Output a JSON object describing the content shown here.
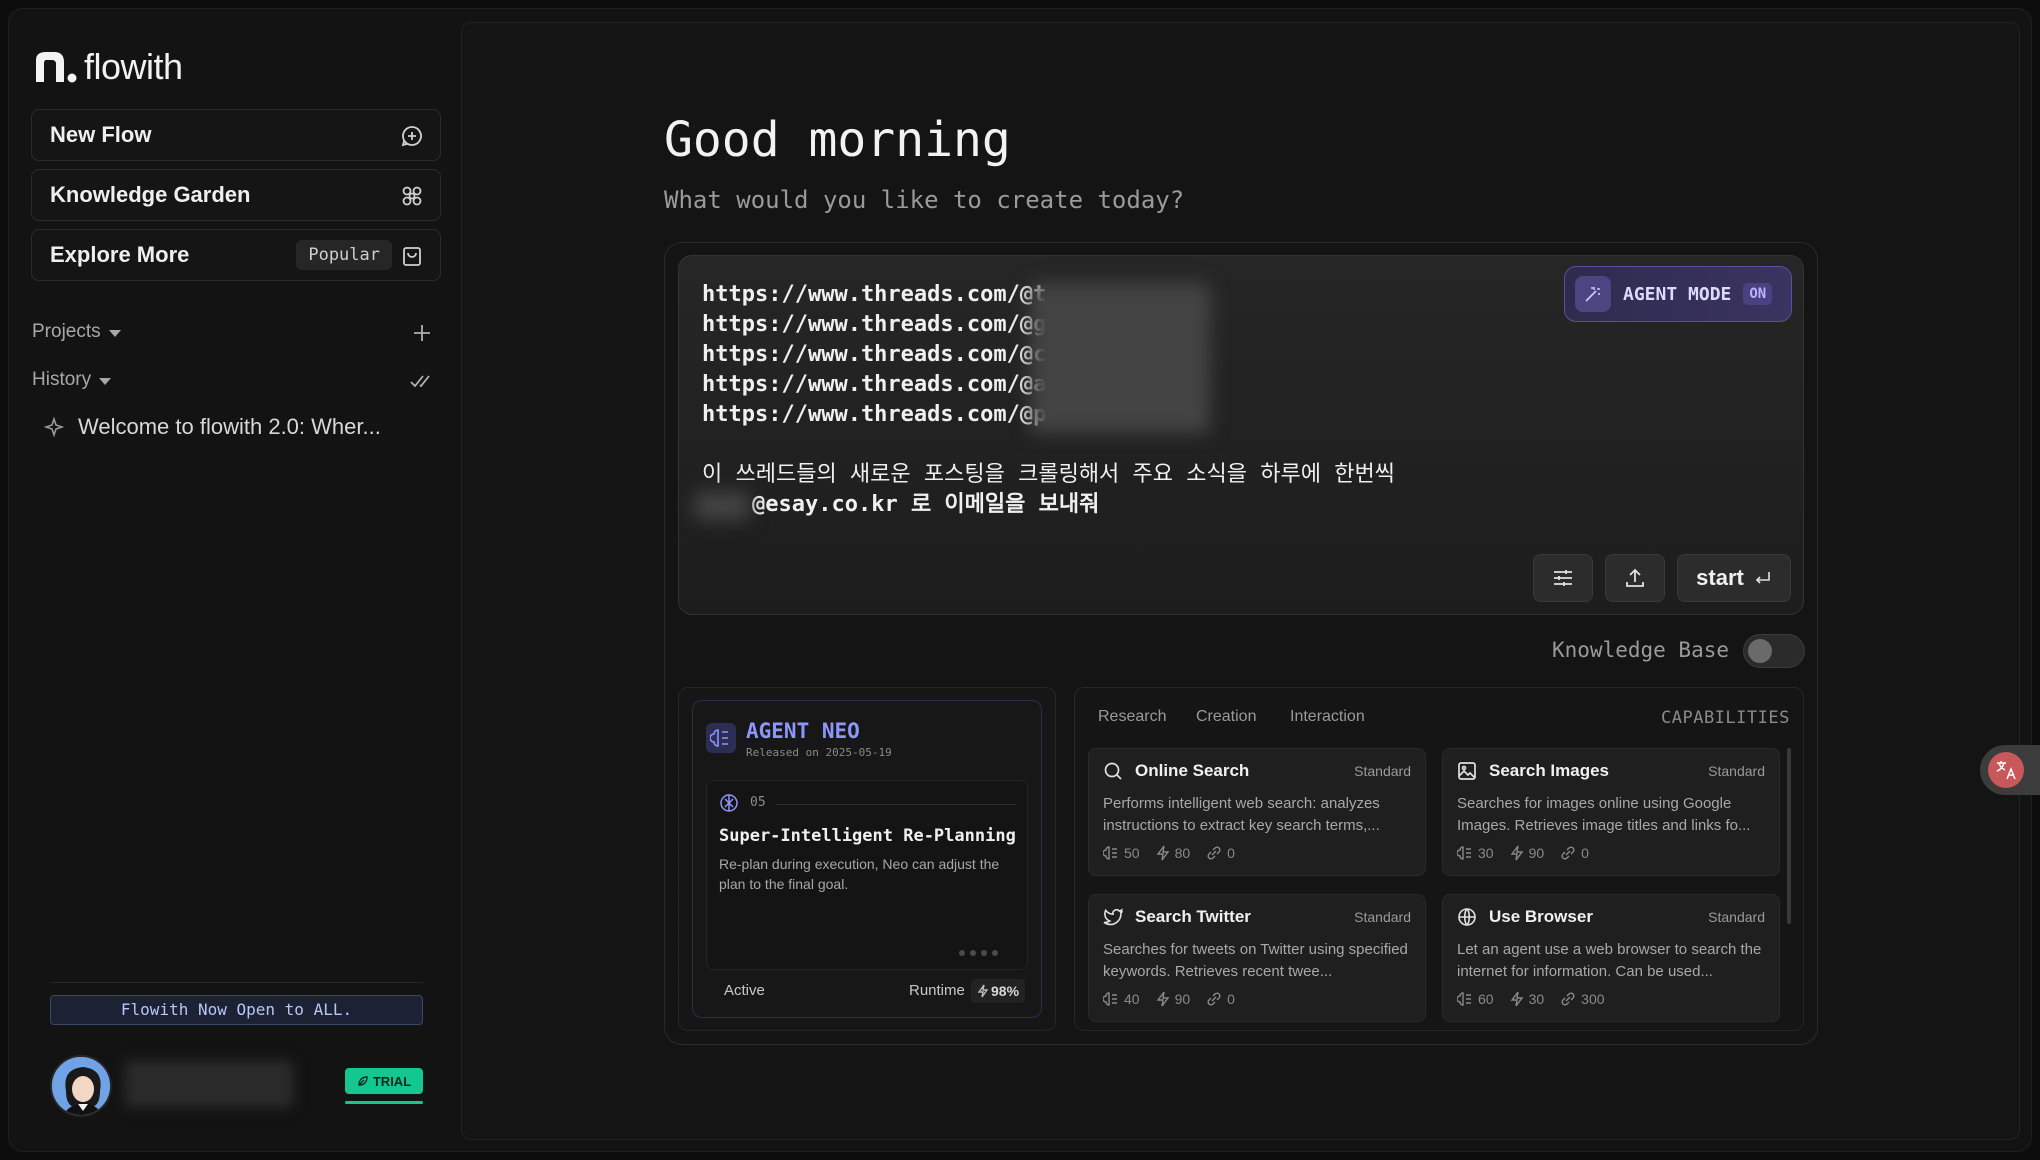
{
  "sidebar": {
    "logo_text": "flowith",
    "new_flow": "New Flow",
    "knowledge_garden": "Knowledge Garden",
    "explore_more": "Explore More",
    "popular_badge": "Popular",
    "projects": "Projects",
    "history": "History",
    "history_items": [
      "Welcome to flowith 2.0: Wher..."
    ],
    "announcement": "Flowith Now Open to ALL.",
    "trial_badge": "TRIAL"
  },
  "main": {
    "greeting": "Good morning",
    "subtitle": "What would you like to create today?",
    "prompt_lines": [
      "https://www.threads.com/@t",
      "https://www.threads.com/@g",
      "https://www.threads.com/@c",
      "https://www.threads.com/@a",
      "https://www.threads.com/@p",
      "",
      "이 쓰레드들의 새로운 포스팅을 크롤링해서 주요 소식을 하루에 한번씩",
      "@esay.co.kr 로 이메일을 보내줘"
    ],
    "agent_mode_label": "AGENT MODE",
    "agent_mode_state": "ON",
    "start_label": "start",
    "knowledge_base_label": "Knowledge Base"
  },
  "agent": {
    "name": "AGENT NEO",
    "released": "Released on 2025-05-19",
    "feature_num": "05",
    "feature_title": "Super-Intelligent Re-Planning",
    "feature_desc": "Re-plan during execution, Neo can adjust the plan to the final goal.",
    "status": "Active",
    "runtime_label": "Runtime",
    "runtime_value": "98%"
  },
  "capabilities": {
    "title": "CAPABILITIES",
    "tabs": [
      "Research",
      "Creation",
      "Interaction"
    ],
    "cards": [
      {
        "name": "Online Search",
        "tier": "Standard",
        "desc": "Performs intelligent web search: analyzes instructions to extract key search terms,...",
        "stats": [
          "50",
          "80",
          "0"
        ],
        "icon": "search-icon"
      },
      {
        "name": "Search Images",
        "tier": "Standard",
        "desc": "Searches for images online using Google Images. Retrieves image titles and links fo...",
        "stats": [
          "30",
          "90",
          "0"
        ],
        "icon": "image-icon"
      },
      {
        "name": "Search Twitter",
        "tier": "Standard",
        "desc": "Searches for tweets on Twitter using specified keywords. Retrieves recent twee...",
        "stats": [
          "40",
          "90",
          "0"
        ],
        "icon": "twitter-icon"
      },
      {
        "name": "Use Browser",
        "tier": "Standard",
        "desc": "Let an agent use a web browser to search the internet for information. Can be used...",
        "stats": [
          "60",
          "30",
          "300"
        ],
        "icon": "globe-icon"
      }
    ]
  },
  "colors": {
    "accent_purple": "#8d95ff",
    "trial_green": "#14c790",
    "background": "#131313"
  }
}
